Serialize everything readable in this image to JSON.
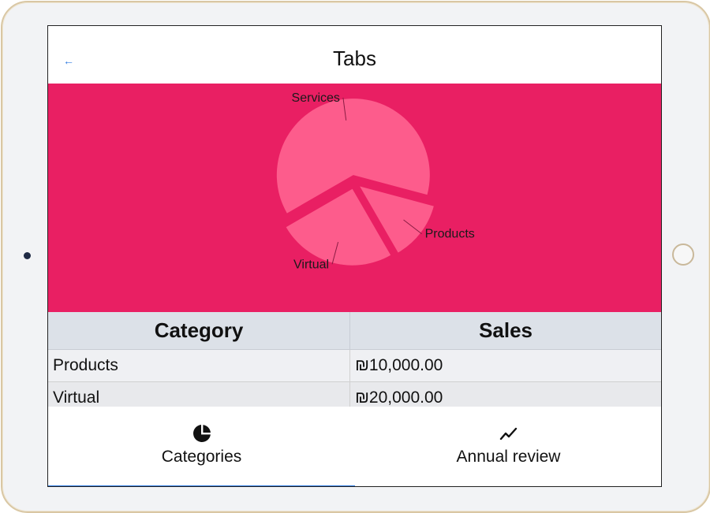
{
  "header": {
    "title": "Tabs",
    "back_icon": "back-arrow-icon"
  },
  "chart_data": {
    "type": "pie",
    "slices": [
      {
        "label": "Services",
        "value": 50000
      },
      {
        "label": "Products",
        "value": 10000
      },
      {
        "label": "Virtual",
        "value": 20000
      }
    ],
    "background_color": "#e91f63",
    "slice_color": "#fd5c8c",
    "exploded": true
  },
  "table": {
    "headers": [
      "Category",
      "Sales"
    ],
    "rows": [
      [
        "Products",
        "₪10,000.00"
      ],
      [
        "Virtual",
        "₪20,000.00"
      ]
    ]
  },
  "tabs": [
    {
      "label": "Categories",
      "icon": "pie-chart-icon",
      "selected": true
    },
    {
      "label": "Annual review",
      "icon": "trend-line-icon",
      "selected": false
    }
  ],
  "colors": {
    "accent": "#2f7be0",
    "chart_bg": "#e91f63",
    "slice": "#fd5c8c"
  }
}
